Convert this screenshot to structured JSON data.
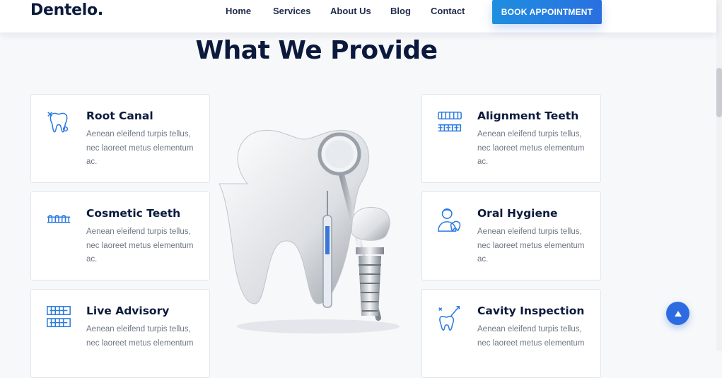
{
  "header": {
    "logo": "Dentelo.",
    "nav": [
      "Home",
      "Services",
      "About Us",
      "Blog",
      "Contact"
    ],
    "cta": "BOOK APPOINTMENT"
  },
  "section": {
    "title": "What We Provide"
  },
  "services": {
    "left": [
      {
        "title": "Root Canal",
        "desc": "Aenean eleifend turpis tellus, nec laoreet metus elementum ac.",
        "icon": "tooth-cavity-icon"
      },
      {
        "title": "Cosmetic Teeth",
        "desc": "Aenean eleifend turpis tellus, nec laoreet metus elementum ac.",
        "icon": "teeth-row-icon"
      },
      {
        "title": "Live Advisory",
        "desc": "Aenean eleifend turpis tellus, nec laoreet metus elementum",
        "icon": "dental-monitor-icon"
      }
    ],
    "right": [
      {
        "title": "Alignment Teeth",
        "desc": "Aenean eleifend turpis tellus, nec laoreet metus elementum ac.",
        "icon": "braces-icon"
      },
      {
        "title": "Oral Hygiene",
        "desc": "Aenean eleifend turpis tellus, nec laoreet metus elementum ac.",
        "icon": "dentist-icon"
      },
      {
        "title": "Cavity Inspection",
        "desc": "Aenean eleifend turpis tellus, nec laoreet metus elementum",
        "icon": "tooth-probe-icon"
      }
    ]
  },
  "colors": {
    "primary": "#0b1a3c",
    "accent": "#2d6ce0",
    "icon": "#2a7be0"
  }
}
